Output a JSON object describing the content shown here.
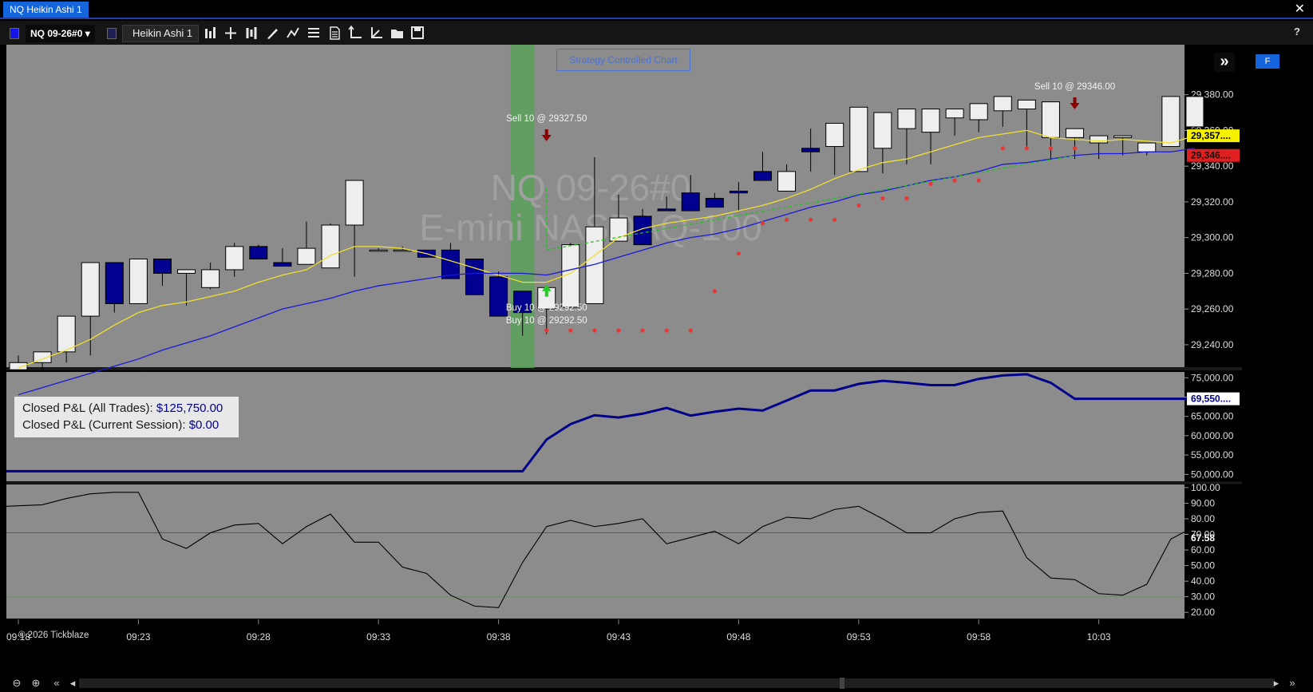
{
  "window": {
    "title": "NQ Heikin Ashi 1",
    "close_label": "✕"
  },
  "toolbar": {
    "symbol": "NQ 09-26#0",
    "template": "Heikin Ashi 1",
    "help": "?",
    "swatch_color_1": "#1414e6",
    "swatch_color_2": "#1e1e50",
    "icons": [
      "chart-type-icon",
      "crosshair-icon",
      "bar-style-icon",
      "draw-pencil-icon",
      "indicator-icon",
      "list-icon",
      "properties-icon",
      "axis-icon",
      "axis-scale-icon",
      "open-folder-icon",
      "save-icon"
    ]
  },
  "chart": {
    "watermark_symbol": "NQ 09-26#0",
    "watermark_name": "E-mini NASDAQ-100",
    "strategy_label": "Strategy Controlled Chart",
    "f_button": "F",
    "fast_forward_icon": "»",
    "copyright": "© 2026 Tickblaze"
  },
  "pnl": {
    "label_all": "Closed P&L (All Trades):",
    "value_all": "$125,750.00",
    "label_session": "Closed P&L (Current Session):",
    "value_session": "$0.00"
  },
  "chart_data": [
    {
      "type": "candlestick",
      "name": "Heikin Ashi",
      "x": [
        "09:18",
        "09:19",
        "09:20",
        "09:21",
        "09:22",
        "09:23",
        "09:24",
        "09:25",
        "09:26",
        "09:27",
        "09:28",
        "09:29",
        "09:30",
        "09:31",
        "09:32",
        "09:33",
        "09:34",
        "09:35",
        "09:36",
        "09:37",
        "09:38",
        "09:39",
        "09:40",
        "09:41",
        "09:42",
        "09:43",
        "09:44",
        "09:45",
        "09:46",
        "09:47",
        "09:48",
        "09:49",
        "09:50",
        "09:51",
        "09:52",
        "09:53",
        "09:54",
        "09:55",
        "09:56",
        "09:57",
        "09:58",
        "09:59",
        "10:00",
        "10:01",
        "10:02",
        "10:03",
        "10:04",
        "10:05",
        "10:06",
        "10:07"
      ],
      "candles": [
        [
          29226,
          29234,
          29226,
          29230
        ],
        [
          29230,
          29236,
          29226,
          29236
        ],
        [
          29236,
          29256,
          29230,
          29256
        ],
        [
          29256,
          29272,
          29234,
          29286
        ],
        [
          29286,
          29258,
          29262,
          29263
        ],
        [
          29263,
          29288,
          29268,
          29288
        ],
        [
          29288,
          29288,
          29273,
          29280
        ],
        [
          29280,
          29276,
          29262,
          29282
        ],
        [
          29272,
          29286,
          29271,
          29282
        ],
        [
          29282,
          29297,
          29278,
          29295
        ],
        [
          29295,
          29292,
          29296,
          29288
        ],
        [
          29286,
          29290,
          29294,
          29284
        ],
        [
          29285,
          29290,
          29309,
          29294
        ],
        [
          29283,
          29308,
          29284,
          29307
        ],
        [
          29307,
          29278,
          29301,
          29332
        ],
        [
          29293,
          29293,
          29294,
          29293
        ],
        [
          29293,
          29293,
          29295,
          29293
        ],
        [
          29293,
          29293,
          29289,
          29289
        ],
        [
          29293,
          29297,
          29280,
          29277
        ],
        [
          29288,
          29285,
          29276,
          29268
        ],
        [
          29278,
          29281,
          29258,
          29256
        ],
        [
          29270,
          29264,
          29245,
          29258
        ],
        [
          29260,
          29262,
          29246,
          29272
        ],
        [
          29261,
          29297,
          29290,
          29296
        ],
        [
          29263,
          29331,
          29345,
          29306
        ],
        [
          29298,
          29324,
          29322,
          29311
        ],
        [
          29312,
          29316,
          29308,
          29296
        ],
        [
          29316,
          29323,
          29316,
          29315
        ],
        [
          29325,
          29335,
          29325,
          29315
        ],
        [
          29322,
          29325,
          29318,
          29317
        ],
        [
          29326,
          29331,
          29315,
          29325
        ],
        [
          29337,
          29348,
          29336,
          29332
        ],
        [
          29326,
          29341,
          29330,
          29337
        ],
        [
          29350,
          29361,
          29337,
          29348
        ],
        [
          29351,
          29364,
          29335,
          29364
        ],
        [
          29337,
          29352,
          29337,
          29373
        ],
        [
          29350,
          29362,
          29336,
          29370
        ],
        [
          29361,
          29357,
          29341,
          29372
        ],
        [
          29359,
          29357,
          29341,
          29372
        ],
        [
          29367,
          29372,
          29357,
          29372
        ],
        [
          29366,
          29375,
          29359,
          29375
        ],
        [
          29371,
          29379,
          29362,
          29379
        ],
        [
          29372,
          29372,
          29351,
          29377
        ],
        [
          29356,
          29350,
          29344,
          29376
        ],
        [
          29356,
          29348,
          29344,
          29361
        ],
        [
          29353,
          29357,
          29344,
          29357
        ],
        [
          29356,
          29353,
          29346,
          29357
        ],
        [
          29348,
          29352,
          29346,
          29353
        ],
        [
          29351,
          29362,
          29358,
          29379
        ],
        [
          29362,
          29365,
          29350,
          29379
        ]
      ],
      "candle_fields": [
        "open",
        "high",
        "low",
        "close"
      ],
      "yrange": [
        29227,
        29408
      ],
      "yticks": [
        29240,
        29260,
        29280,
        29300,
        29320,
        29340,
        29360,
        29380
      ],
      "price_labels": {
        "current": "29,357....",
        "level": "29,346...."
      },
      "yellow_ma": [
        29227,
        29232,
        29237,
        29243,
        29251,
        29258,
        29262,
        29264,
        29267,
        29270,
        29275,
        29279,
        29282,
        29290,
        29295,
        29295,
        29294,
        29291,
        29287,
        29283,
        29279,
        29275,
        29275,
        29280,
        29290,
        29300,
        29305,
        29308,
        29310,
        29312,
        29315,
        29318,
        29322,
        29327,
        29333,
        29338,
        29342,
        29344,
        29348,
        29352,
        29356,
        29358,
        29360,
        29356,
        29355,
        29354,
        29355,
        29354,
        29353,
        29357
      ],
      "blue_ma": [
        29212,
        29216,
        29220,
        29224,
        29228,
        29232,
        29237,
        29241,
        29245,
        29250,
        29255,
        29260,
        29263,
        29266,
        29270,
        29273,
        29275,
        29277,
        29279,
        29280,
        29280,
        29280,
        29279,
        29282,
        29285,
        29289,
        29293,
        29297,
        29300,
        29302,
        29305,
        29309,
        29313,
        29317,
        29320,
        29324,
        29326,
        29329,
        29332,
        29334,
        29337,
        29341,
        29342,
        29344,
        29346,
        29347,
        29347,
        29348,
        29348,
        29350
      ],
      "stop_dots": [
        [
          22,
          29248
        ],
        [
          23,
          29248
        ],
        [
          24,
          29248
        ],
        [
          25,
          29248
        ],
        [
          26,
          29248
        ],
        [
          27,
          29248
        ],
        [
          28,
          29248
        ],
        [
          29,
          29270
        ],
        [
          30,
          29291
        ],
        [
          31,
          29308
        ],
        [
          32,
          29310
        ],
        [
          33,
          29310
        ],
        [
          34,
          29310
        ],
        [
          35,
          29318
        ],
        [
          36,
          29322
        ],
        [
          37,
          29322
        ],
        [
          38,
          29330
        ],
        [
          39,
          29332
        ],
        [
          40,
          29332
        ],
        [
          41,
          29350
        ],
        [
          42,
          29350
        ],
        [
          43,
          29350
        ],
        [
          44,
          29350
        ]
      ],
      "trades": [
        {
          "label": "Sell 10 @ 29327.50",
          "price": 29327.5,
          "bar": 22,
          "side": "sell"
        },
        {
          "label": "Buy 10 @ 29292.50",
          "price": 29292.5,
          "bar": 22,
          "side": "buy"
        },
        {
          "label": "Buy 10 @ 29292.50",
          "price": 29292.5,
          "bar": 22,
          "side": "buy"
        },
        {
          "label": "Sell 10 @ 29346.00",
          "price": 29346.0,
          "bar": 44,
          "side": "sell"
        }
      ],
      "trade_line": {
        "from": [
          22,
          29293
        ],
        "to": [
          44,
          29346
        ]
      },
      "highlight_bars": [
        21,
        21
      ]
    },
    {
      "type": "line",
      "name": "Closed P&L",
      "x": [
        "09:18",
        "09:19",
        "09:20",
        "09:21",
        "09:22",
        "09:23",
        "09:24",
        "09:25",
        "09:26",
        "09:27",
        "09:28",
        "09:29",
        "09:30",
        "09:31",
        "09:32",
        "09:33",
        "09:34",
        "09:35",
        "09:36",
        "09:37",
        "09:38",
        "09:39",
        "09:40",
        "09:41",
        "09:42",
        "09:43",
        "09:44",
        "09:45",
        "09:46",
        "09:47",
        "09:48",
        "09:49",
        "09:50",
        "09:51",
        "09:52",
        "09:53",
        "09:54",
        "09:55",
        "09:56",
        "09:57",
        "09:58",
        "09:59",
        "10:00",
        "10:01",
        "10:02",
        "10:03",
        "10:04",
        "10:05",
        "10:06",
        "10:07"
      ],
      "values": [
        50800,
        50800,
        50800,
        50800,
        50800,
        50800,
        50800,
        50800,
        50800,
        50800,
        50800,
        50800,
        50800,
        50800,
        50800,
        50800,
        50800,
        50800,
        50800,
        50800,
        50800,
        50800,
        59000,
        63000,
        65300,
        64700,
        65700,
        67200,
        65200,
        66200,
        67000,
        66500,
        69100,
        71700,
        71700,
        73400,
        74200,
        73700,
        73100,
        73100,
        74700,
        75600,
        75900,
        73700,
        69550,
        69550,
        69550,
        69550,
        69550,
        69550
      ],
      "yrange": [
        48200,
        76500
      ],
      "yticks": [
        50000,
        55000,
        60000,
        65000,
        70000,
        75000
      ],
      "price_label": "69,550...."
    },
    {
      "type": "line",
      "name": "Oscillator",
      "x": [
        "09:18",
        "09:19",
        "09:20",
        "09:21",
        "09:22",
        "09:23",
        "09:24",
        "09:25",
        "09:26",
        "09:27",
        "09:28",
        "09:29",
        "09:30",
        "09:31",
        "09:32",
        "09:33",
        "09:34",
        "09:35",
        "09:36",
        "09:37",
        "09:38",
        "09:39",
        "09:40",
        "09:41",
        "09:42",
        "09:43",
        "09:44",
        "09:45",
        "09:46",
        "09:47",
        "09:48",
        "09:49",
        "09:50",
        "09:51",
        "09:52",
        "09:53",
        "09:54",
        "09:55",
        "09:56",
        "09:57",
        "09:58",
        "09:59",
        "10:00",
        "10:01",
        "10:02",
        "10:03",
        "10:04",
        "10:05",
        "10:06",
        "10:07"
      ],
      "values": [
        88,
        89,
        93,
        96,
        97,
        97,
        67,
        61,
        71,
        76,
        77,
        64,
        75,
        83,
        65,
        65,
        49,
        45,
        31,
        24,
        23,
        52,
        75,
        79,
        75,
        77,
        80,
        64,
        68,
        72,
        64,
        75,
        81,
        80,
        86,
        88,
        80,
        71,
        71,
        80,
        84,
        85,
        55,
        42,
        41,
        32,
        31,
        38,
        67,
        75
      ],
      "yrange": [
        16,
        102
      ],
      "yticks": [
        20,
        30,
        40,
        50,
        60,
        70,
        80,
        90,
        100
      ],
      "red_level": 71,
      "green_level": 30,
      "price_label": "67.58"
    }
  ],
  "x_axis": {
    "labels": [
      "09:18",
      "09:23",
      "09:28",
      "09:33",
      "09:38",
      "09:43",
      "09:48",
      "09:53",
      "09:58",
      "10:03"
    ]
  }
}
